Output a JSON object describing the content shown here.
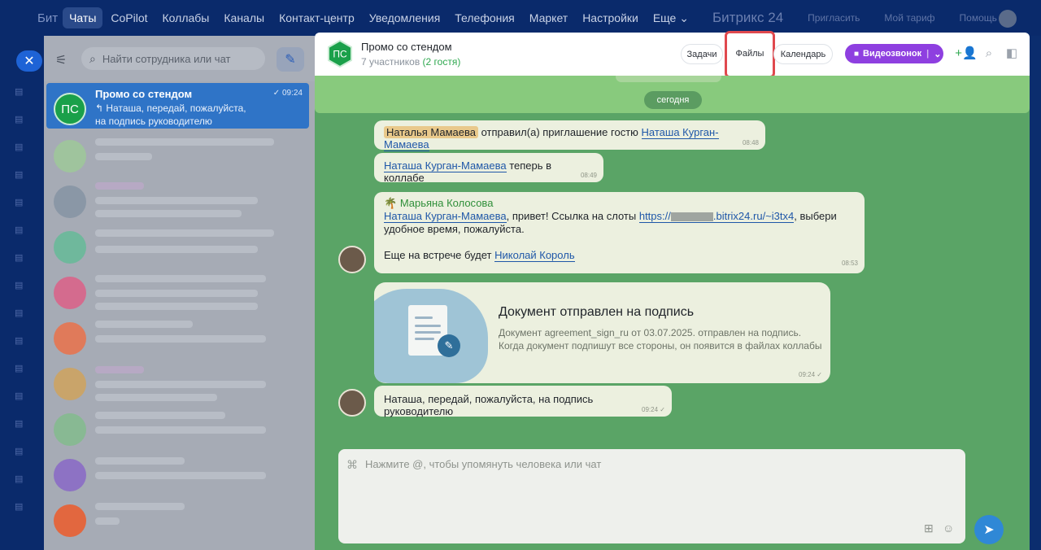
{
  "nav": {
    "brand": "Бит",
    "items": [
      "Чаты",
      "CoPilot",
      "Коллабы",
      "Каналы",
      "Контакт-центр",
      "Уведомления",
      "Телефония",
      "Маркет",
      "Настройки",
      "Еще"
    ],
    "logo": "Битрикс 24",
    "invite": "Пригласить",
    "tariff": "Мой тариф",
    "help": "Помощь"
  },
  "search": {
    "placeholder": "Найти сотрудника или чат"
  },
  "active_chat": {
    "initials": "ПС",
    "title": "Промо со стендом",
    "time": "09:24",
    "preview": "↰ Наташа, передай, пожалуйста, на подпись руководителю"
  },
  "header": {
    "initials": "ПС",
    "title": "Промо со стендом",
    "participants": "7 участников",
    "guests": "(2 гостя)",
    "tasks": "Задачи",
    "files": "Файлы",
    "calendar": "Календарь",
    "video": "Видеозвонок"
  },
  "date_pill": "сегодня",
  "messages": {
    "m1": {
      "user": "Наталья Мамаева",
      "text": "отправил(а) приглашение гостю",
      "guest": "Наташа Курган-Мамаева",
      "time": "08:48"
    },
    "m2": {
      "guest": "Наташа Курган-Мамаева",
      "text": "теперь в коллабе",
      "time": "08:49"
    },
    "m3": {
      "author": "Марьяна Колосова",
      "mention": "Наташа Курган-Мамаева",
      "text1": ", привет! Ссылка на слоты",
      "link_a": "https://",
      "link_b": ".bitrix24.ru/~i3tx4",
      "text2": ", выбери удобное время, пожалуйста.",
      "text3": "Еще на встрече будет",
      "mention2": "Николай Король",
      "time": "08:53"
    },
    "doc": {
      "title": "Документ отправлен на подпись",
      "text": "Документ agreement_sign_ru от 03.07.2025. отправлен на подпись. Когда документ подпишут все стороны, он появится в файлах коллабы",
      "time": "09:24"
    },
    "m4": {
      "text": "Наташа, передай, пожалуйста, на подпись руководителю",
      "time": "09:24"
    }
  },
  "composer": {
    "placeholder": "Нажмите @, чтобы упомянуть человека или чат"
  },
  "colors": {
    "accent": "#8e3fe0",
    "highlight_border": "#e0494e",
    "chat_bg": "#5aa466"
  }
}
